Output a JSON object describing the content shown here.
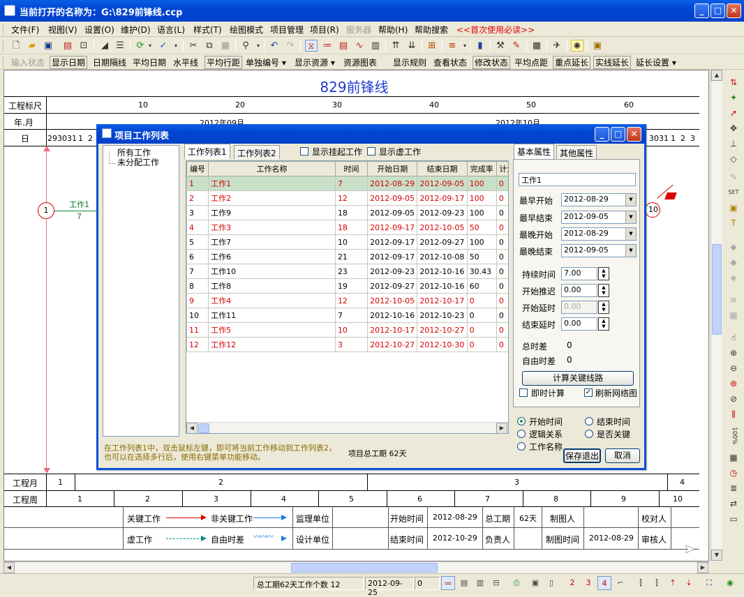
{
  "window": {
    "title": "当前打开的名称为：G:\\829前锋线.ccp"
  },
  "menu": [
    "文件(F)",
    "视图(V)",
    "设置(O)",
    "维护(D)",
    "语言(L)",
    "样式(T)",
    "绘图模式",
    "项目管理",
    "项目(R)",
    "服务器",
    "帮助(H)",
    "帮助搜索",
    "<<首次使用必读>>"
  ],
  "toolbar2": [
    "输入状态",
    "显示日期",
    "日期隔线",
    "平均日期",
    "水平线",
    "平均行距",
    "单独编号 ▾",
    "显示资源 ▾",
    "资源图表",
    "显示规则",
    "查看状态",
    "修改状态",
    "平均点距",
    "重点延长",
    "实线延长",
    "延长设置 ▾"
  ],
  "chart": {
    "title": "829前锋线",
    "row_labels": {
      "scale": "工程标尺",
      "yearmonth": "年.月",
      "day": "日",
      "proj_month": "工程月",
      "proj_week": "工程周"
    },
    "scale_ticks": [
      "10",
      "20",
      "30",
      "40",
      "50",
      "60"
    ],
    "months": [
      "2012年09月",
      "2012年10月"
    ],
    "days_left": [
      "29",
      "30",
      "31",
      "1",
      "2"
    ],
    "days_right": [
      "30",
      "31",
      "1",
      "2",
      "3"
    ],
    "proj_months": [
      "1",
      "2",
      "3",
      "4"
    ],
    "proj_weeks": [
      "1",
      "2",
      "3",
      "4",
      "5",
      "6",
      "7",
      "8",
      "9",
      "10"
    ],
    "node_start": "1",
    "node_end": "10",
    "task_label": "工作1",
    "task_duration": "7"
  },
  "legend": {
    "critical": "关键工作",
    "noncritical": "非关键工作",
    "virtual": "虚工作",
    "free_float": "自由时差",
    "supervisor": "监理单位",
    "designer": "设计单位",
    "start_label": "开始时间",
    "start_value": "2012-08-29",
    "end_label": "结束时间",
    "end_value": "2012-10-29",
    "total_label": "总工期",
    "total_value": "62天",
    "owner_label": "负责人",
    "drawer_label": "制图人",
    "draw_time_label": "制图时间",
    "draw_time_value": "2012-08-29",
    "checker_label": "校对人",
    "auditor_label": "审核人"
  },
  "dialog": {
    "title": "项目工作列表",
    "tree": [
      "所有工作",
      "未分配工作"
    ],
    "tabs": [
      "工作列表1",
      "工作列表2"
    ],
    "show_suspended": "显示挂起工作",
    "show_virtual": "显示虚工作",
    "columns": [
      "编号",
      "工作名称",
      "时间",
      "开始日期",
      "结束日期",
      "完成率",
      "计划"
    ],
    "rows": [
      {
        "id": "1",
        "name": "工作1",
        "dur": "7",
        "start": "2012-08-29",
        "end": "2012-09-05",
        "pct": "100",
        "plan": "0",
        "red": true,
        "selected": true
      },
      {
        "id": "2",
        "name": "工作2",
        "dur": "12",
        "start": "2012-09-05",
        "end": "2012-09-17",
        "pct": "100",
        "plan": "0",
        "red": true
      },
      {
        "id": "3",
        "name": "工作9",
        "dur": "18",
        "start": "2012-09-05",
        "end": "2012-09-23",
        "pct": "100",
        "plan": "0",
        "red": false
      },
      {
        "id": "4",
        "name": "工作3",
        "dur": "18",
        "start": "2012-09-17",
        "end": "2012-10-05",
        "pct": "50",
        "plan": "0",
        "red": true
      },
      {
        "id": "5",
        "name": "工作7",
        "dur": "10",
        "start": "2012-09-17",
        "end": "2012-09-27",
        "pct": "100",
        "plan": "0",
        "red": false
      },
      {
        "id": "6",
        "name": "工作6",
        "dur": "21",
        "start": "2012-09-17",
        "end": "2012-10-08",
        "pct": "50",
        "plan": "0",
        "red": false
      },
      {
        "id": "7",
        "name": "工作10",
        "dur": "23",
        "start": "2012-09-23",
        "end": "2012-10-16",
        "pct": "30.43",
        "plan": "0",
        "red": false
      },
      {
        "id": "8",
        "name": "工作8",
        "dur": "19",
        "start": "2012-09-27",
        "end": "2012-10-16",
        "pct": "60",
        "plan": "0",
        "red": false
      },
      {
        "id": "9",
        "name": "工作4",
        "dur": "12",
        "start": "2012-10-05",
        "end": "2012-10-17",
        "pct": "0",
        "plan": "0",
        "red": true
      },
      {
        "id": "10",
        "name": "工作11",
        "dur": "7",
        "start": "2012-10-16",
        "end": "2012-10-23",
        "pct": "0",
        "plan": "0",
        "red": false
      },
      {
        "id": "11",
        "name": "工作5",
        "dur": "10",
        "start": "2012-10-17",
        "end": "2012-10-27",
        "pct": "0",
        "plan": "0",
        "red": true
      },
      {
        "id": "12",
        "name": "工作12",
        "dur": "3",
        "start": "2012-10-27",
        "end": "2012-10-30",
        "pct": "0",
        "plan": "0",
        "red": true
      }
    ],
    "hint": "在工作列表1中，双击鼠标左键，即可将当前工作移动到工作列表2，也可以在选择多行后，使用右键菜单功能移动。",
    "total_duration": "项目总工期  62天",
    "prop_tabs": [
      "基本属性",
      "其他属性"
    ],
    "name_value": "工作1",
    "es_label": "最早开始",
    "es_value": "2012-08-29",
    "ef_label": "最早结束",
    "ef_value": "2012-09-05",
    "ls_label": "最晚开始",
    "ls_value": "2012-08-29",
    "lf_label": "最晚结束",
    "lf_value": "2012-09-05",
    "dur_label": "持续时间",
    "dur_value": "7.00",
    "delay_start_label": "开始推迟",
    "delay_start_value": "0.00",
    "lag_start_label": "开始延时",
    "lag_start_value": "0.00",
    "lag_end_label": "结束延时",
    "lag_end_value": "0.00",
    "total_float_label": "总时差",
    "total_float_value": "0",
    "free_float_label": "自由时差",
    "free_float_value": "0",
    "calc_button": "计算关键线路",
    "instant_calc": "即时计算",
    "refresh_net": "刷新网络图",
    "sort_start": "开始时间",
    "sort_end": "结束时间",
    "sort_logic": "逻辑关系",
    "sort_critical": "是否关键",
    "sort_name": "工作名称",
    "save_exit": "保存退出",
    "cancel": "取消"
  },
  "status": {
    "summary": "总工期62天工作个数  12",
    "date": "2012-09-25",
    "value": "0"
  },
  "colors": {
    "accent": "#0a4ed6",
    "critical": "#e00000",
    "noncritical": "#1e78e6",
    "title_text": "#1f3ad0"
  }
}
